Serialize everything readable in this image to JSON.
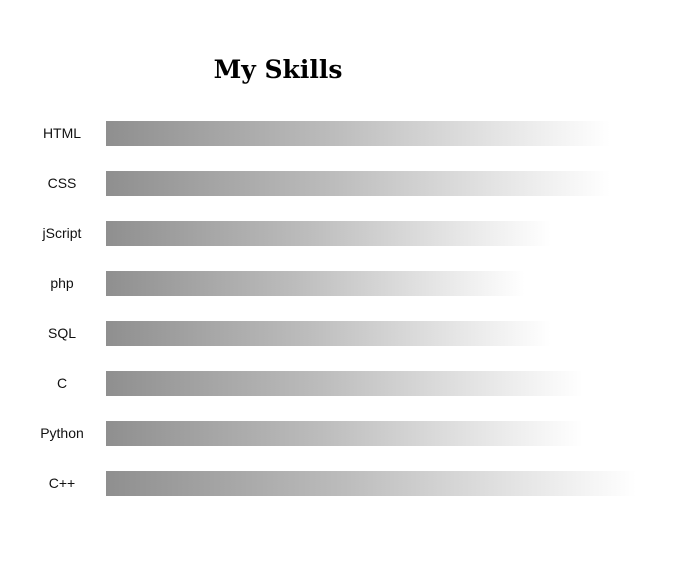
{
  "title": "My Skills",
  "skills": [
    {
      "name": "HTML",
      "level": 0.95
    },
    {
      "name": "CSS",
      "level": 0.95
    },
    {
      "name": "jScript",
      "level": 0.84
    },
    {
      "name": "php",
      "level": 0.79
    },
    {
      "name": "SQL",
      "level": 0.84
    },
    {
      "name": "C",
      "level": 0.9
    },
    {
      "name": "Python",
      "level": 0.9
    },
    {
      "name": "C++",
      "level": 1.0
    }
  ]
}
